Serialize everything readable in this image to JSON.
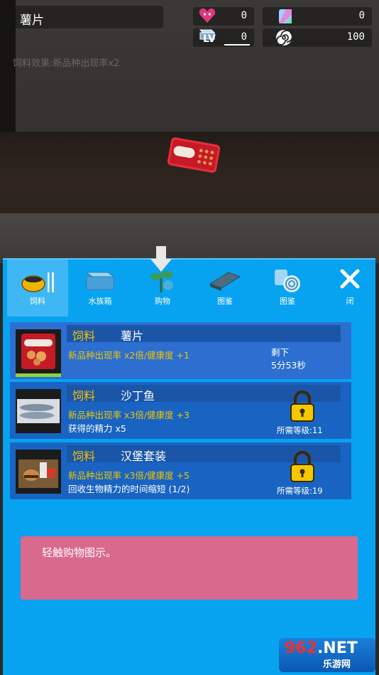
{
  "hud": {
    "item_title": "薯片",
    "love": "0",
    "crystal": "0",
    "lv_label": "LV",
    "lv_value": "0",
    "energy": "100",
    "effect_text": "饲料效果:新品种出现率x2"
  },
  "tabs": [
    {
      "label": "饲料",
      "icon": "food-bowl-icon",
      "active": true
    },
    {
      "label": "水族箱",
      "icon": "aquarium-icon",
      "active": false
    },
    {
      "label": "购物",
      "icon": "sprout-icon",
      "active": false
    },
    {
      "label": "图鉴",
      "icon": "book-icon",
      "active": false
    },
    {
      "label": "图鉴",
      "icon": "spiral-card-icon",
      "active": false
    },
    {
      "label": "闭",
      "icon": "close-icon",
      "active": false
    }
  ],
  "items": [
    {
      "category": "饲料",
      "name": "薯片",
      "effect": "新品种出现率 x2倍/健康度 +1",
      "remain_label": "剩下",
      "remain_time": "5分53秒"
    },
    {
      "category": "饲料",
      "name": "沙丁鱼",
      "effect": "新品种出现率 x3倍/健康度 +3",
      "effect2": "获得的精力 x5",
      "required": "所需等级:11"
    },
    {
      "category": "饲料",
      "name": "汉堡套装",
      "effect": "新品种出现率 x3倍/健康度 +5",
      "effect2": "回收生物精力的时间缩短 (1/2)",
      "required": "所需等级:19"
    }
  ],
  "hint": "轻触购物图示。",
  "watermark": {
    "top_a": "962",
    "top_b": ".NET",
    "bottom": "乐游网"
  },
  "colors": {
    "panel": "#07a3f0",
    "item": "#1964c2",
    "accent_yellow": "#f1c400",
    "hint_pink": "#d96a8e"
  }
}
